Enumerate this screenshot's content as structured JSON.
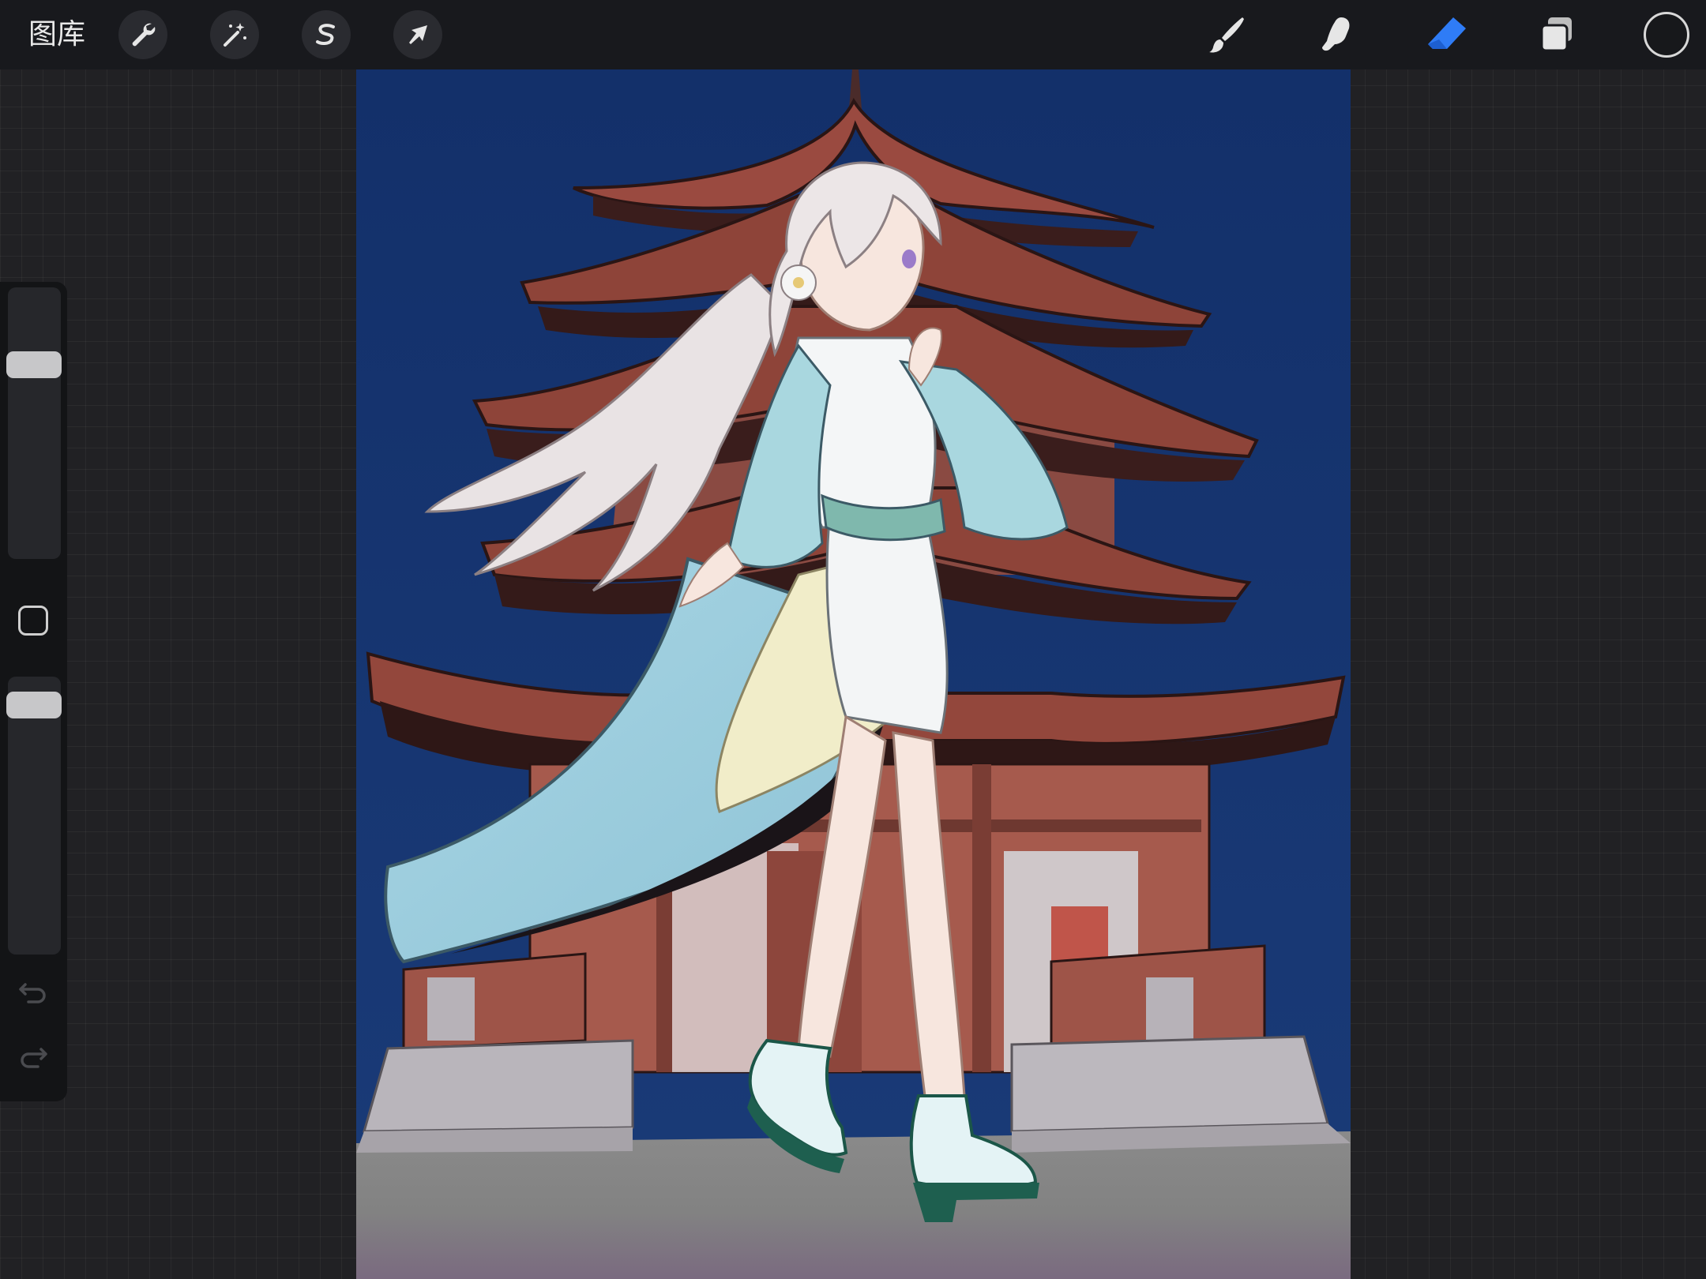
{
  "toolbar": {
    "gallery_label": "图库",
    "actions_icon": "wrench-icon",
    "adjustments_icon": "magic-wand-icon",
    "selection_icon": "selection-s-icon",
    "transform_icon": "arrow-cursor-icon",
    "brush_icon": "brush-icon",
    "smudge_icon": "smudge-finger-icon",
    "eraser_icon": "eraser-icon",
    "layers_icon": "layers-icon",
    "active_tool": "eraser",
    "active_color": "#17181b",
    "accent_color": "#2f7cf6"
  },
  "sidebar": {
    "brush_size_level": 0.74,
    "opacity_level": 0.94,
    "modify_icon": "square-icon",
    "undo_icon": "undo-icon",
    "redo_icon": "redo-icon"
  },
  "canvas": {
    "artwork": "anime-girl-walking-in-front-of-pagoda",
    "sky_color": "#153164",
    "ground_color": "#858585"
  }
}
